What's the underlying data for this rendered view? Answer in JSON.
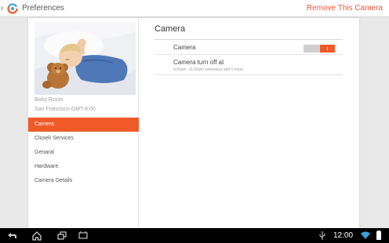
{
  "actionbar": {
    "up_caret": "‹",
    "title": "Preferences",
    "remove_label": "Remove This Camera",
    "logo_icon": "closeli-logo-icon"
  },
  "camera": {
    "name": "Baby Room",
    "timezone": "San Francisco GMT-8:00",
    "photo": "sleeping-baby-with-teddy-bear"
  },
  "nav": {
    "items": [
      {
        "label": "Camera",
        "active": true
      },
      {
        "label": "Closeli Services",
        "active": false
      },
      {
        "label": "Genaral",
        "active": false
      },
      {
        "label": "Hardware",
        "active": false
      },
      {
        "label": "Camera Details",
        "active": false
      }
    ]
  },
  "settings": {
    "heading": "Camera",
    "camera_toggle": {
      "label": "Camera",
      "on": true
    },
    "turn_off": {
      "title": "Camera turn off at",
      "subtitle": "9:00am -11:00am weekdays and 1 more"
    }
  },
  "sysbar": {
    "time": "12:00",
    "icons": [
      "back-icon",
      "home-icon",
      "recent-apps-icon",
      "screenshot-icon",
      "usb-icon",
      "wifi-icon",
      "battery-icon"
    ]
  },
  "colors": {
    "accent": "#f05a28",
    "remove_text": "#e8583a",
    "sysbar": "#000000"
  }
}
